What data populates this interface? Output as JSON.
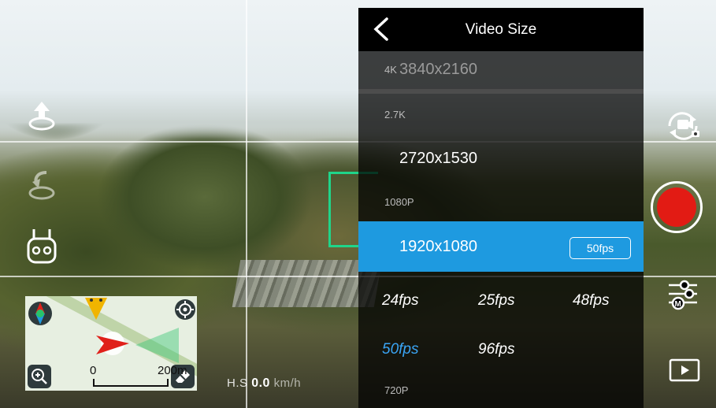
{
  "panel": {
    "title": "Video Size",
    "groups": {
      "g4k": {
        "label": "4K",
        "options": [
          "3840x2160"
        ]
      },
      "g27k": {
        "label": "2.7K",
        "options": [
          "2720x1530"
        ]
      },
      "g1080": {
        "label": "1080P",
        "options": [
          "1920x1080"
        ]
      },
      "g720": {
        "label": "720P"
      }
    },
    "selected": {
      "resolution": "1920x1080",
      "fps_badge": "50fps"
    },
    "fps_options": [
      "24fps",
      "25fps",
      "48fps",
      "50fps",
      "96fps"
    ],
    "selected_fps": "50fps"
  },
  "map": {
    "scale_start": "0",
    "scale_end": "200m"
  },
  "telemetry": {
    "hs_label": "H.S",
    "hs_value": "0.0",
    "hs_unit": "km/h"
  },
  "colors": {
    "accent_blue": "#1e9ae0",
    "record_red": "#e21b14",
    "focus_green": "#1fd58a"
  },
  "icons": {
    "left": [
      "takeoff-icon",
      "return-home-icon",
      "remote-controller-icon"
    ],
    "right": [
      "switch-camera-icon",
      "record-button",
      "camera-settings-icon",
      "playback-icon"
    ],
    "map": [
      "compass-icon",
      "locate-icon",
      "zoom-in-icon",
      "eraser-icon"
    ]
  }
}
